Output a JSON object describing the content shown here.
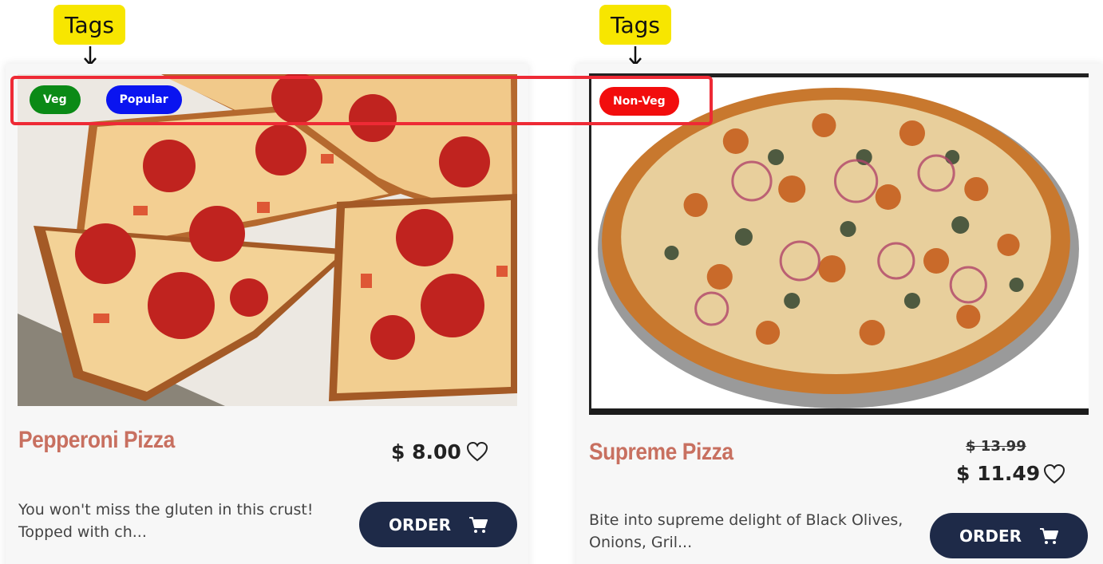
{
  "annotations": {
    "callouts": [
      {
        "label": "Tags"
      },
      {
        "label": "Tags"
      }
    ],
    "highlight_color": "#ee2a35",
    "callout_color": "#f7e600"
  },
  "products": [
    {
      "name": "Pepperoni Pizza",
      "tags": [
        {
          "label": "Veg",
          "color": "#0b8a16"
        },
        {
          "label": "Popular",
          "color": "#0a14f0"
        }
      ],
      "price": "$ 8.00",
      "description": "You won't miss the gluten in this crust! Topped with ch...",
      "order_label": "ORDER",
      "image_icon": "pepperoni-pizza-image"
    },
    {
      "name": "Supreme Pizza",
      "tags": [
        {
          "label": "Non-Veg",
          "color": "#f20d0d"
        }
      ],
      "old_price": "$ 13.99",
      "price": "$ 11.49",
      "description": "Bite into supreme delight of Black Olives, Onions, Gril...",
      "order_label": "ORDER",
      "image_icon": "supreme-pizza-image"
    }
  ],
  "colors": {
    "title": "#c87060",
    "button": "#1e2a48",
    "card_bg": "#f7f7f7"
  }
}
